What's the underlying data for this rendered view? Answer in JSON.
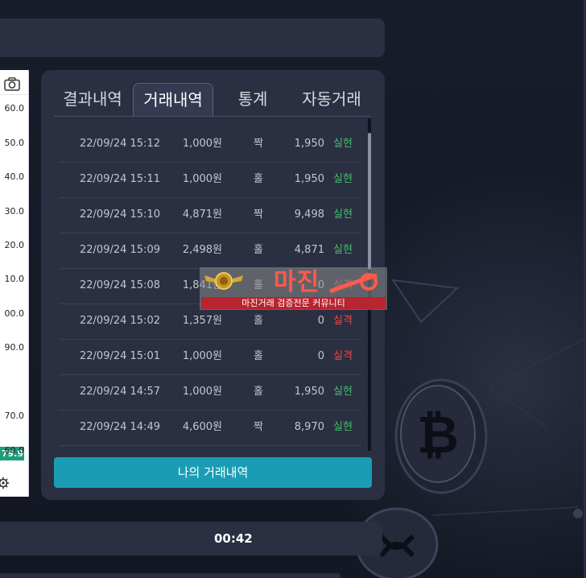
{
  "chart": {
    "ticks": [
      "60.0",
      "50.0",
      "40.0",
      "30.0",
      "20.0",
      "10.0",
      "00.0",
      "90.0",
      "70.0",
      "60.0"
    ],
    "current_price": "79.9"
  },
  "panel": {
    "tabs": [
      {
        "label": "결과내역",
        "active": false
      },
      {
        "label": "거래내역",
        "active": true
      },
      {
        "label": "통계",
        "active": false
      },
      {
        "label": "자동거래",
        "active": false
      }
    ],
    "rows": [
      {
        "time": "22/09/24 15:12",
        "amount": "1,000원",
        "pick": "짝",
        "value": "1,950",
        "result": "실현",
        "status": "win"
      },
      {
        "time": "22/09/24 15:11",
        "amount": "1,000원",
        "pick": "홀",
        "value": "1,950",
        "result": "실현",
        "status": "win"
      },
      {
        "time": "22/09/24 15:10",
        "amount": "4,871원",
        "pick": "짝",
        "value": "9,498",
        "result": "실현",
        "status": "win"
      },
      {
        "time": "22/09/24 15:09",
        "amount": "2,498원",
        "pick": "홀",
        "value": "4,871",
        "result": "실현",
        "status": "win"
      },
      {
        "time": "22/09/24 15:08",
        "amount": "1,841원",
        "pick": "홀",
        "value": "0",
        "result": "실격",
        "status": "lose"
      },
      {
        "time": "22/09/24 15:02",
        "amount": "1,357원",
        "pick": "홀",
        "value": "0",
        "result": "실격",
        "status": "lose"
      },
      {
        "time": "22/09/24 15:01",
        "amount": "1,000원",
        "pick": "홀",
        "value": "0",
        "result": "실격",
        "status": "lose"
      },
      {
        "time": "22/09/24 14:57",
        "amount": "1,000원",
        "pick": "홀",
        "value": "1,950",
        "result": "실현",
        "status": "win"
      },
      {
        "time": "22/09/24 14:49",
        "amount": "4,600원",
        "pick": "짝",
        "value": "8,970",
        "result": "실현",
        "status": "win"
      }
    ],
    "my_history_button": "나의 거래내역"
  },
  "timer": "00:42",
  "watermark": {
    "title": "마진",
    "subtitle": "마진거래 검증전문 커뮤니티"
  },
  "colors": {
    "accent": "#1a9db4",
    "win": "#3fbf6a",
    "lose": "#e24b4b",
    "price_tag": "#1b9e7b"
  },
  "icons": [
    "camera-icon",
    "gear-icon",
    "bitcoin-coin-icon",
    "ripple-coin-icon",
    "wing-emblem-icon"
  ]
}
